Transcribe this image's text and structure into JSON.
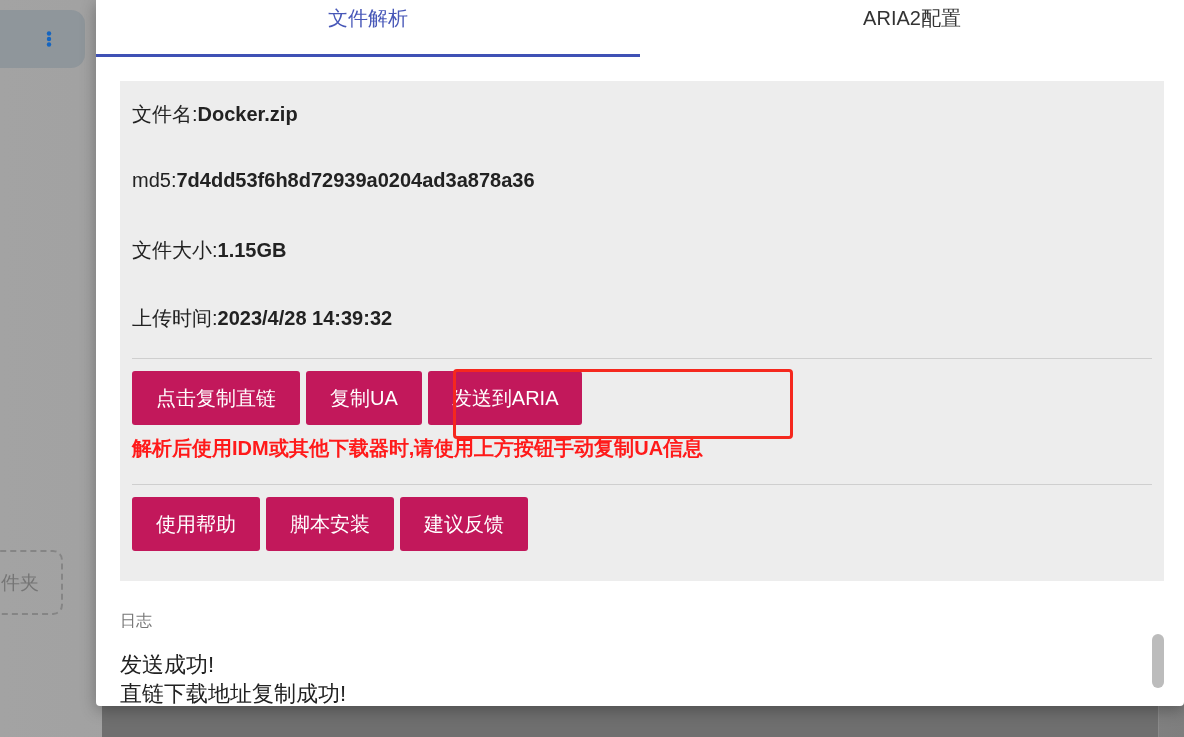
{
  "background": {
    "folder_button": "件夹"
  },
  "dialog": {
    "tabs": [
      {
        "label": "文件解析",
        "selected": true
      },
      {
        "label": "ARIA2配置",
        "selected": false
      }
    ],
    "info": [
      "文件名:**Docker.zip**",
      "md5:**7d4dd53f6h8d72939a0204ad3a878a36**",
      "文件大小:**1.15GB**",
      "上传时间:**2023/4/28 14:39:32**"
    ],
    "actions": [
      "点击复制直链",
      "复制UA",
      "发送到ARIA"
    ],
    "warning": "解析后使用IDM或其他下载器时,请使用上方按钮手动复制UA信息",
    "help_buttons": [
      "使用帮助",
      "脚本安装",
      "建议反馈"
    ],
    "log": {
      "label": "日志",
      "lines": [
        "发送成功!",
        "直链下载地址复制成功!"
      ]
    }
  },
  "annotation": {
    "shown": true
  }
}
